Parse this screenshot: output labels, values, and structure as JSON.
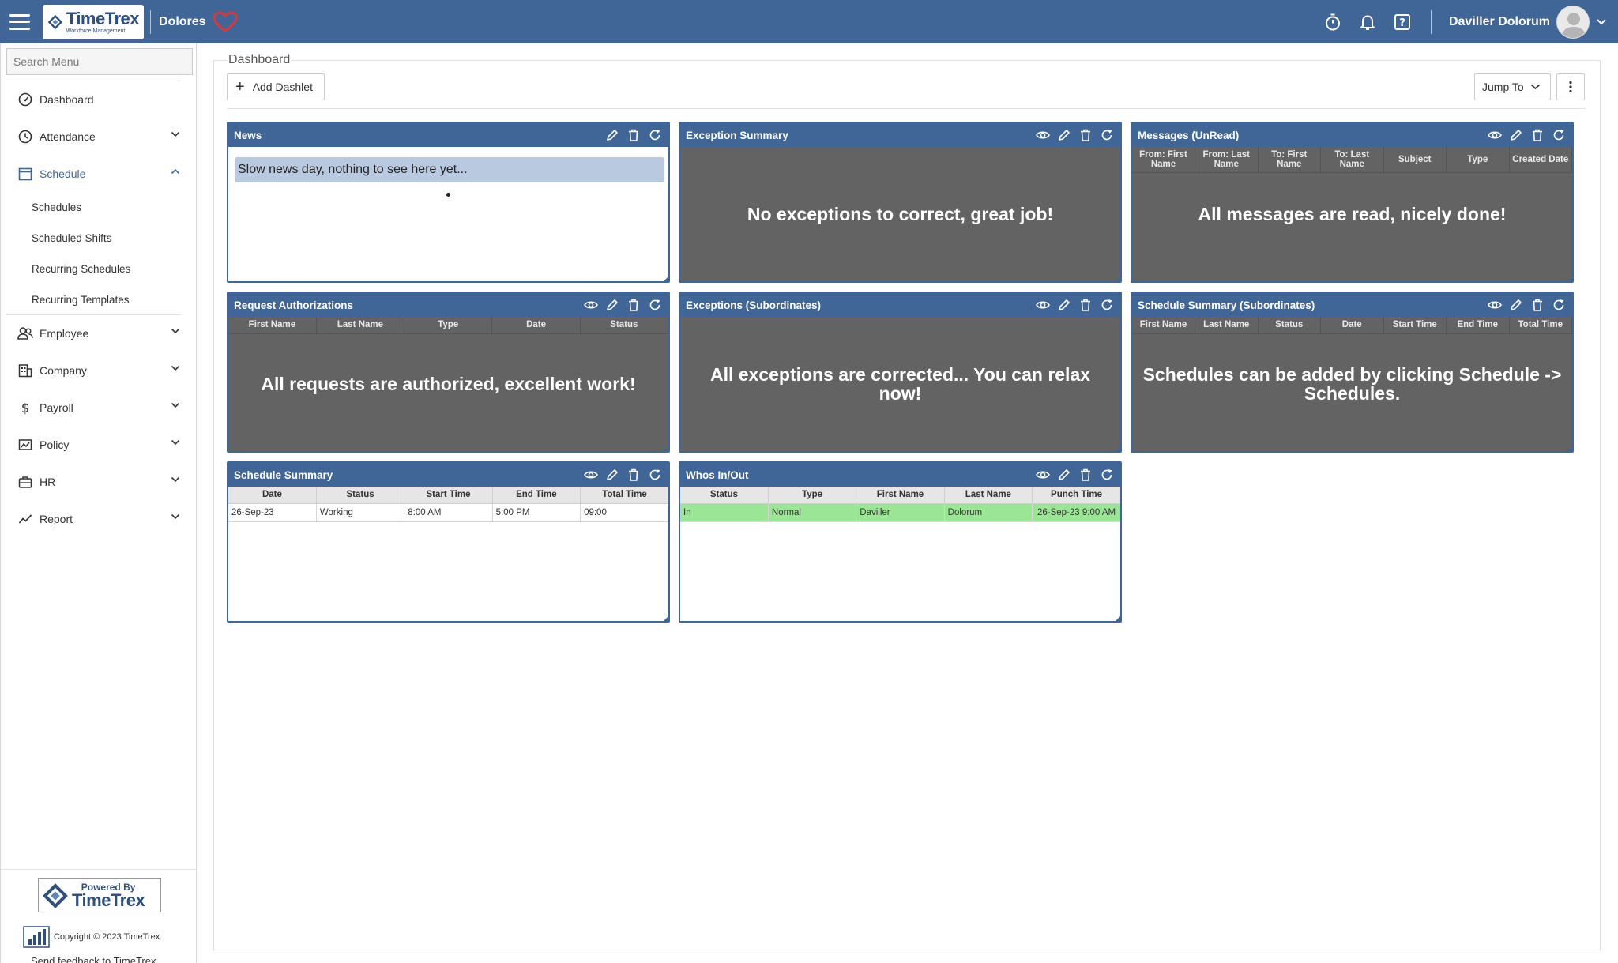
{
  "header": {
    "logo_main": "TimeTrex",
    "logo_sub": "Workforce Management",
    "company_name": "Dolores",
    "user_name": "Daviller Dolorum",
    "colors": {
      "bar": "#3f6696",
      "heart": "#d9373f"
    }
  },
  "sidebar": {
    "search_placeholder": "Search Menu",
    "items": [
      {
        "label": "Dashboard",
        "icon": "dashboard-gauge-icon"
      },
      {
        "label": "Attendance",
        "icon": "clock-icon"
      },
      {
        "label": "Schedule",
        "icon": "calendar-icon"
      },
      {
        "label": "Employee",
        "icon": "users-icon"
      },
      {
        "label": "Company",
        "icon": "building-icon"
      },
      {
        "label": "Payroll",
        "icon": "dollar-icon"
      },
      {
        "label": "Policy",
        "icon": "policy-icon"
      },
      {
        "label": "HR",
        "icon": "briefcase-icon"
      },
      {
        "label": "Report",
        "icon": "chart-line-icon"
      }
    ],
    "schedule_sub": [
      "Schedules",
      "Scheduled Shifts",
      "Recurring Schedules",
      "Recurring Templates"
    ],
    "footer": {
      "powered_by": "Powered By",
      "powered_brand": "TimeTrex",
      "copyright": "Copyright © 2023 TimeTrex.",
      "feedback": "Send feedback to TimeTrex"
    }
  },
  "main": {
    "title": "Dashboard",
    "add_dashlet": "Add Dashlet",
    "jump_to": "Jump To"
  },
  "dashlets": {
    "news": {
      "title": "News",
      "text": "Slow news day, nothing to see here yet..."
    },
    "exception_summary": {
      "title": "Exception Summary",
      "message": "No exceptions to correct, great job!"
    },
    "messages": {
      "title": "Messages (UnRead)",
      "columns": [
        "From: First Name",
        "From: Last Name",
        "To: First Name",
        "To: Last Name",
        "Subject",
        "Type",
        "Created Date"
      ],
      "message": "All messages are read, nicely done!"
    },
    "request_auth": {
      "title": "Request Authorizations",
      "columns": [
        "First Name",
        "Last Name",
        "Type",
        "Date",
        "Status"
      ],
      "message": "All requests are authorized, excellent work!"
    },
    "exceptions_sub": {
      "title": "Exceptions (Subordinates)",
      "message": "All exceptions are corrected... You can relax now!"
    },
    "schedule_summary_sub": {
      "title": "Schedule Summary (Subordinates)",
      "columns": [
        "First Name",
        "Last Name",
        "Status",
        "Date",
        "Start Time",
        "End Time",
        "Total Time"
      ],
      "message": "Schedules can be added by clicking Schedule -> Schedules."
    },
    "schedule_summary": {
      "title": "Schedule Summary",
      "columns": [
        "Date",
        "Status",
        "Start Time",
        "End Time",
        "Total Time"
      ],
      "rows": [
        [
          "26-Sep-23",
          "Working",
          "8:00 AM",
          "5:00 PM",
          "09:00"
        ]
      ]
    },
    "whos_in_out": {
      "title": "Whos In/Out",
      "columns": [
        "Status",
        "Type",
        "First Name",
        "Last Name",
        "Punch Time"
      ],
      "rows": [
        [
          "In",
          "Normal",
          "Daviller",
          "Dolorum",
          "26-Sep-23 9:00 AM"
        ]
      ],
      "row_color": "#9be695"
    }
  }
}
